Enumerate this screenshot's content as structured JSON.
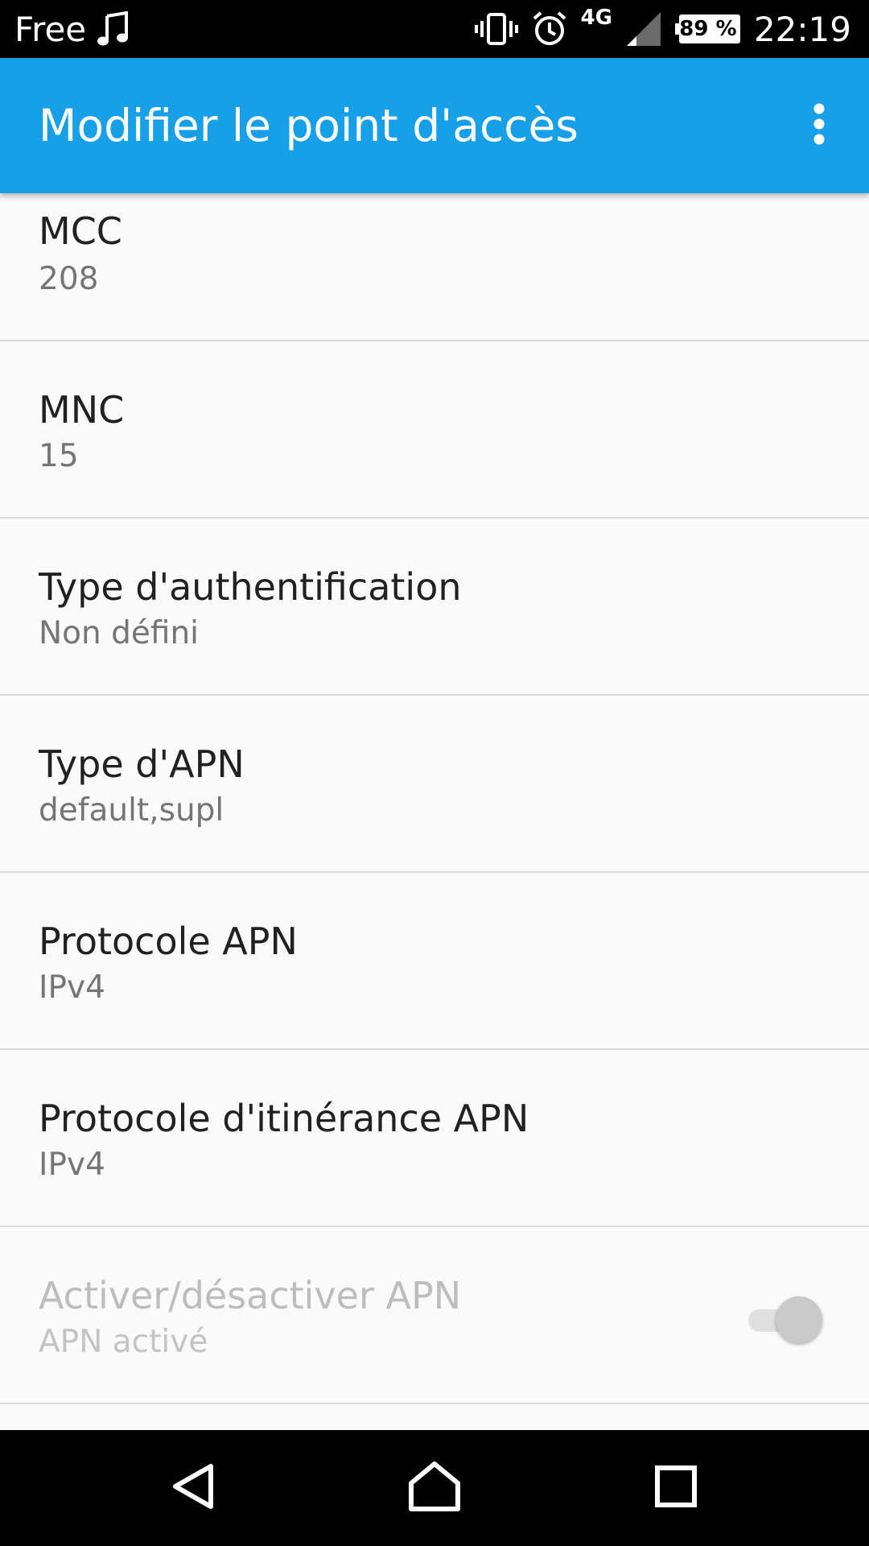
{
  "status_bar": {
    "carrier": "Free",
    "network_type": "4G",
    "battery": "89 %",
    "time": "22:19",
    "icons": [
      "music-note-icon",
      "vibrate-icon",
      "alarm-icon",
      "signal-icon",
      "battery-icon"
    ]
  },
  "app_bar": {
    "title": "Modifier le point d'accès",
    "menu_icon": "more-vert-icon",
    "background": "#179fe8"
  },
  "preferences": [
    {
      "title": "MCC",
      "summary": "208"
    },
    {
      "title": "MNC",
      "summary": "15"
    },
    {
      "title": "Type d'authentification",
      "summary": "Non défini"
    },
    {
      "title": "Type d'APN",
      "summary": "default,supl"
    },
    {
      "title": "Protocole APN",
      "summary": "IPv4"
    },
    {
      "title": "Protocole d'itinérance APN",
      "summary": "IPv4"
    },
    {
      "title": "Activer/désactiver APN",
      "summary": "APN activé",
      "toggle": "on",
      "enabled": false
    }
  ],
  "nav_bar": {
    "icons": [
      "back-icon",
      "home-icon",
      "recents-icon"
    ]
  }
}
